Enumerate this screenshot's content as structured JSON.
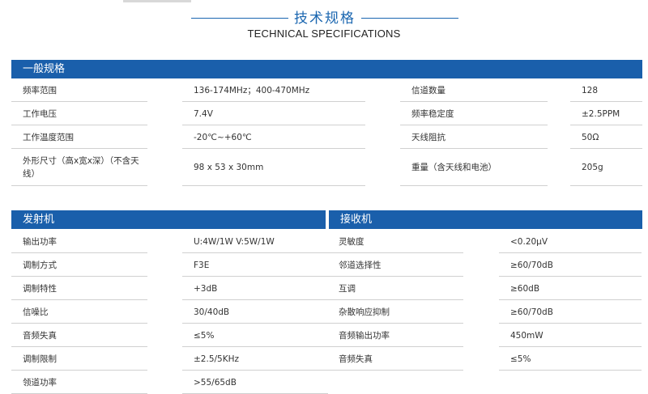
{
  "header": {
    "title_cn": "技术规格",
    "title_en": "TECHNICAL SPECIFICATIONS"
  },
  "general": {
    "title": "一般规格",
    "rows": [
      {
        "l1": "频率范围",
        "v1": "136-174MHz；400-470MHz",
        "l2": "信道数量",
        "v2": "128"
      },
      {
        "l1": "工作电压",
        "v1": "7.4V",
        "l2": "频率稳定度",
        "v2": "±2.5PPM"
      },
      {
        "l1": "工作温度范围",
        "v1": "-20℃~+60℃",
        "l2": "天线阻抗",
        "v2": "50Ω"
      },
      {
        "l1": "外形尺寸（高x宽x深）（不含天线）",
        "v1": "98 x 53 x 30mm",
        "l2": "重量（含天线和电池）",
        "v2": "205g"
      }
    ]
  },
  "transmitter": {
    "title": "发射机",
    "rows": [
      {
        "label": "输出功率",
        "value": "U:4W/1W V:5W/1W"
      },
      {
        "label": "调制方式",
        "value": "F3E"
      },
      {
        "label": "调制特性",
        "value": "+3dB"
      },
      {
        "label": "信噪比",
        "value": "30/40dB"
      },
      {
        "label": "音频失真",
        "value": "≤5%"
      },
      {
        "label": "调制限制",
        "value": "±2.5/5KHz"
      },
      {
        "label": "领道功率",
        "value": ">55/65dB"
      }
    ]
  },
  "receiver": {
    "title": "接收机",
    "rows": [
      {
        "label": "灵敏度",
        "value": "<0.20μV"
      },
      {
        "label": "邻道选择性",
        "value": "≥60/70dB"
      },
      {
        "label": "互调",
        "value": "≥60dB"
      },
      {
        "label": "杂散响应抑制",
        "value": "≥60/70dB"
      },
      {
        "label": "音频输出功率",
        "value": "450mW"
      },
      {
        "label": "音频失真",
        "value": "≤5%"
      }
    ]
  },
  "colors": {
    "section_bar": "#1a5fab",
    "title_accent": "#1a66b0",
    "row_line": "#d0d0d0"
  }
}
